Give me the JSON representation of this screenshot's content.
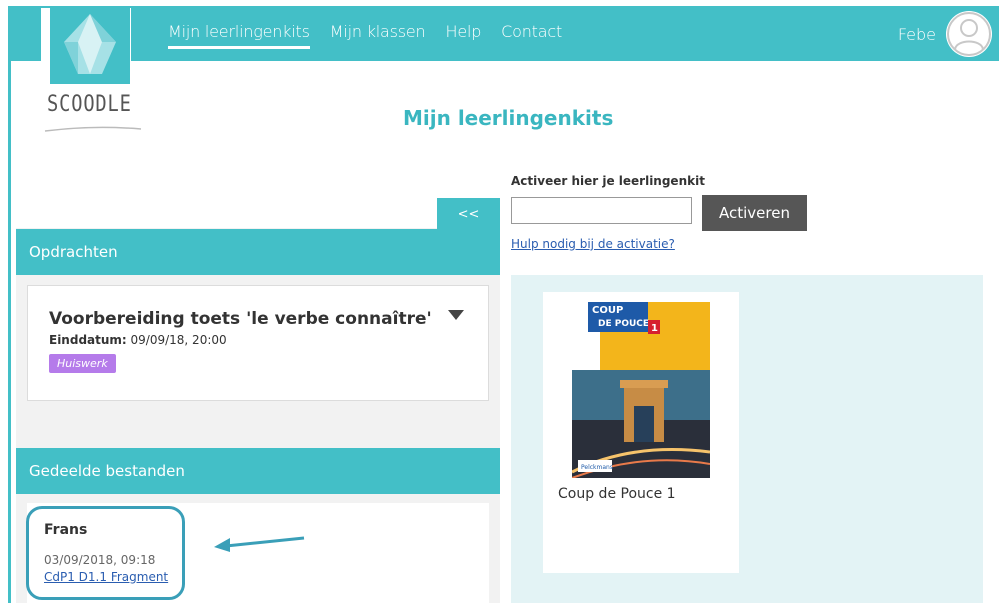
{
  "nav": {
    "items": [
      {
        "label": "Mijn leerlingenkits",
        "active": true
      },
      {
        "label": "Mijn klassen",
        "active": false
      },
      {
        "label": "Help",
        "active": false
      },
      {
        "label": "Contact",
        "active": false
      }
    ],
    "user_name": "Febe",
    "avatar_icon": "user-avatar-icon"
  },
  "logo": {
    "text": "SCOODLE"
  },
  "page": {
    "title": "Mijn leerlingenkits"
  },
  "colors": {
    "accent": "#43bfc7",
    "title": "#3ab6c0",
    "tag": "#b57bea",
    "button": "#565656",
    "panel": "#e3f3f5"
  },
  "left": {
    "collapse_label": "<<",
    "assignments": {
      "header": "Opdrachten",
      "task": {
        "title": "Voorbereiding toets 'le verbe connaître'",
        "due_label": "Einddatum:",
        "due_value": " 09/09/18, 20:00",
        "tag": "Huiswerk"
      }
    },
    "shared": {
      "header": "Gedeelde bestanden",
      "file": {
        "title": "Frans",
        "date": "03/09/2018, 09:18",
        "link": "CdP1 D1.1 Fragment"
      }
    }
  },
  "activation": {
    "label": "Activeer hier je leerlingenkit",
    "input_value": "",
    "input_placeholder": "",
    "button": "Activeren",
    "help_link": "Hulp nodig bij de activatie?"
  },
  "kits": [
    {
      "name": "Coup de Pouce 1",
      "cover_line1": "COUP",
      "cover_line2": "DE POUCE",
      "cover_num": "1",
      "publisher": "Pelckmans"
    }
  ]
}
